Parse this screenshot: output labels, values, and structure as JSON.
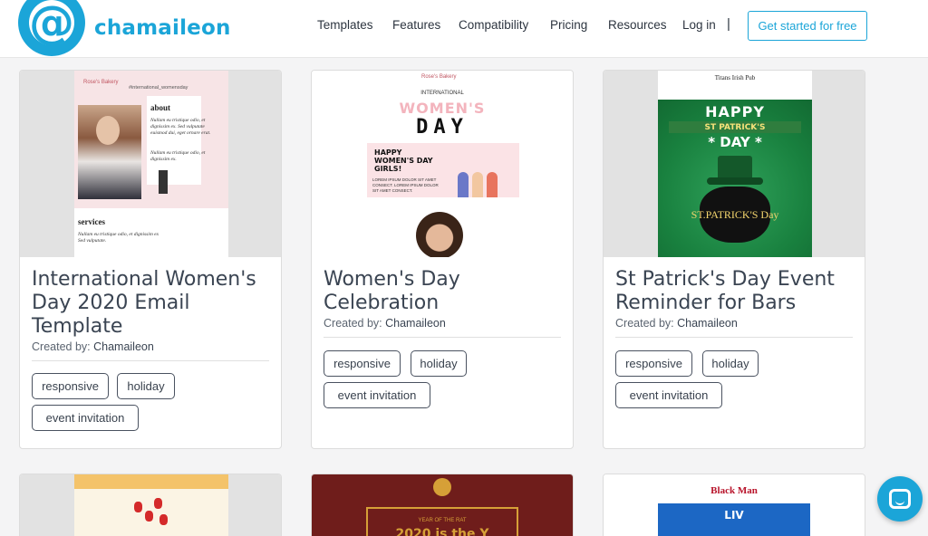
{
  "brand": {
    "name": "chamaileon",
    "logo_glyph": "@",
    "accent_color": "#1ba5d8"
  },
  "nav": {
    "items": [
      "Templates",
      "Features",
      "Compatibility",
      "Pricing",
      "Resources"
    ],
    "login": "Log in",
    "separator": "|",
    "cta": "Get started for free"
  },
  "cards": [
    {
      "title": "International Women's Day 2020 Email Template",
      "created_by_label": "Created by:",
      "creator": "Chamaileon",
      "tags": [
        "responsive",
        "holiday",
        "event invitation"
      ],
      "thumbnail": {
        "logo": "Rose's Bakery",
        "hashtag": "#international_womensday",
        "heading": "about",
        "body": "Nullam eu tristique odio, et dignissim ex. Sed vulputate euismod dui, eget ornare erat.",
        "body2": "Nullam eu tristique odio, et dignissim ex.",
        "section": "services",
        "section_body": "Nullam eu tristique odio, et dignissim ex Sed vulputate."
      }
    },
    {
      "title": "Women's Day Celebration",
      "created_by_label": "Created by:",
      "creator": "Chamaileon",
      "tags": [
        "responsive",
        "holiday",
        "event invitation"
      ],
      "thumbnail": {
        "logo": "Rose's Bakery",
        "line1": "INTERNATIONAL",
        "line2": "WOMEN'S",
        "line3": "DAY",
        "banner": "HAPPY WOMEN'S DAY GIRLS!",
        "banner_body": "LOREM IPSUM DOLOR SIT AMET CONSECT. LOREM IPSUM DOLOR SIT AMET CONSECT."
      }
    },
    {
      "title": "St Patrick's Day Event Reminder for Bars",
      "created_by_label": "Created by:",
      "creator": "Chamaileon",
      "tags": [
        "responsive",
        "holiday",
        "event invitation"
      ],
      "thumbnail": {
        "pub": "Titans Irish Pub",
        "line1": "HAPPY",
        "line2": "ST PATRICK'S",
        "line3": "* DAY *",
        "pot_label": "ST.PATRICK'S Day"
      }
    }
  ],
  "bottom_row": {
    "card2": {
      "year_label": "YEAR OF THE RAT",
      "headline": "2020 is the Y"
    },
    "card3": {
      "brand": "Black Man",
      "line": "LIV"
    }
  },
  "chat": {
    "icon": "chat-bubble-icon"
  }
}
